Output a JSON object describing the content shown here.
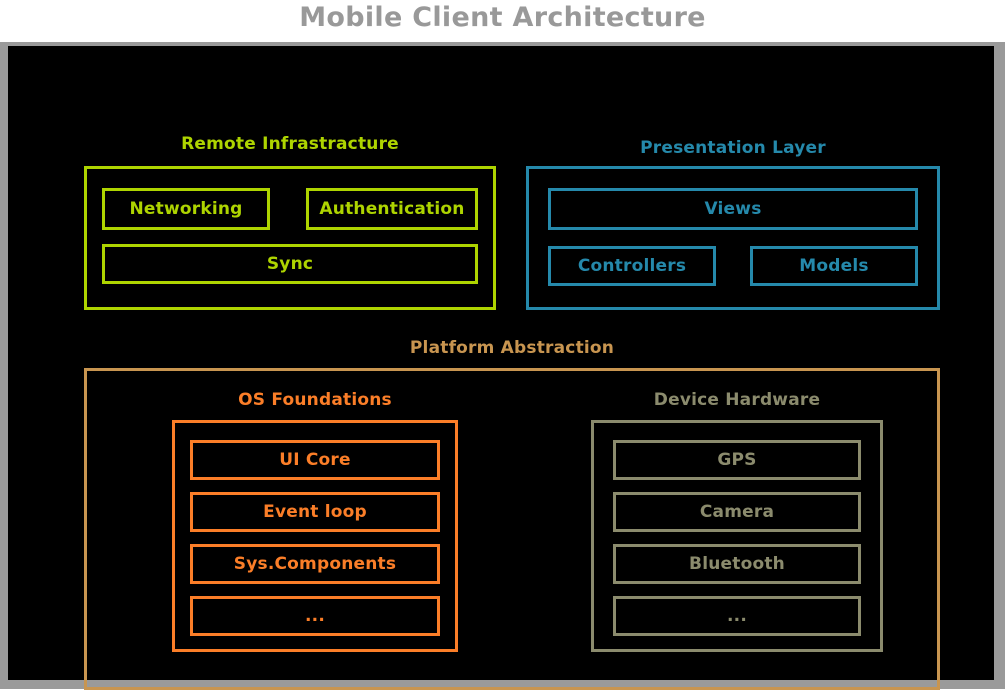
{
  "title": "Mobile Client Architecture",
  "colors": {
    "title": "#999999",
    "frame": "#9a9a9a",
    "canvas": "#000000",
    "remote_infrastructure": "#aed400",
    "presentation_layer": "#2589ab",
    "platform_abstraction": "#c89550",
    "os_foundations": "#fb7e28",
    "device_hardware": "#8b8b6d"
  },
  "groups": {
    "remote": {
      "label": "Remote Infrastracture",
      "nodes": [
        {
          "label": "Networking"
        },
        {
          "label": "Authentication"
        },
        {
          "label": "Sync"
        }
      ]
    },
    "presentation": {
      "label": "Presentation Layer",
      "nodes": [
        {
          "label": "Views"
        },
        {
          "label": "Controllers"
        },
        {
          "label": "Models"
        }
      ]
    },
    "platform": {
      "label": "Platform Abstraction",
      "subgroups": {
        "os_foundations": {
          "label": "OS Foundations",
          "nodes": [
            {
              "label": "UI Core"
            },
            {
              "label": "Event loop"
            },
            {
              "label": "Sys.Components"
            },
            {
              "label": "..."
            }
          ]
        },
        "device_hardware": {
          "label": "Device Hardware",
          "nodes": [
            {
              "label": "GPS"
            },
            {
              "label": "Camera"
            },
            {
              "label": "Bluetooth"
            },
            {
              "label": "..."
            }
          ]
        }
      }
    }
  }
}
